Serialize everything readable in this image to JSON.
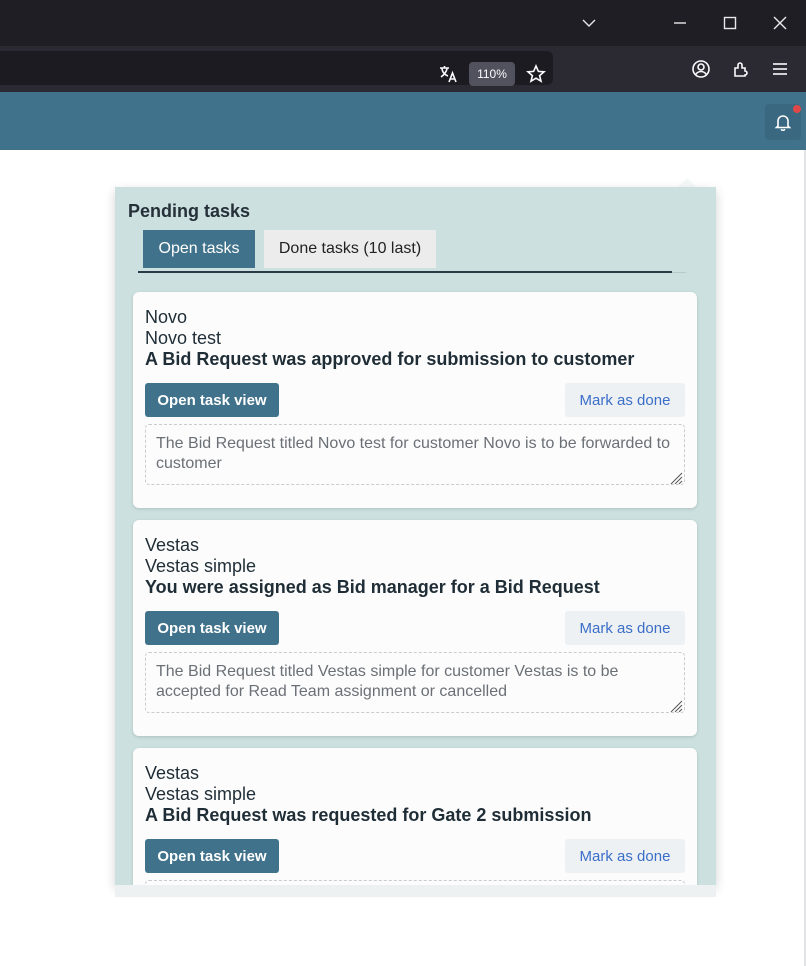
{
  "browser": {
    "zoom_level": "110%",
    "icons": [
      "chevron-down-icon",
      "minimize-icon",
      "maximize-icon",
      "close-icon",
      "translate-icon",
      "star-icon",
      "account-icon",
      "extensions-icon",
      "menu-icon"
    ]
  },
  "header": {
    "accent": "#41728c",
    "notification_icon": "bell-icon"
  },
  "popover": {
    "title": "Pending tasks",
    "tabs": [
      {
        "label": "Open tasks",
        "active": true
      },
      {
        "label": "Done tasks (10 last)",
        "active": false
      }
    ],
    "tasks": [
      {
        "customer": "Novo",
        "bid_title": "Novo test",
        "event": "A Bid Request was approved for submission to customer",
        "open_label": "Open task view",
        "done_label": "Mark as done",
        "description": "The Bid Request titled Novo test for customer Novo is to be forwarded to customer"
      },
      {
        "customer": "Vestas",
        "bid_title": "Vestas simple",
        "event": "You were assigned as Bid manager for a Bid Request",
        "open_label": "Open task view",
        "done_label": "Mark as done",
        "description": "The Bid Request titled Vestas simple for customer Vestas is to be accepted for Read Team assignment or cancelled"
      },
      {
        "customer": "Vestas",
        "bid_title": "Vestas simple",
        "event": "A Bid Request was requested for Gate 2 submission",
        "open_label": "Open task view",
        "done_label": "Mark as done",
        "description": ""
      }
    ]
  }
}
